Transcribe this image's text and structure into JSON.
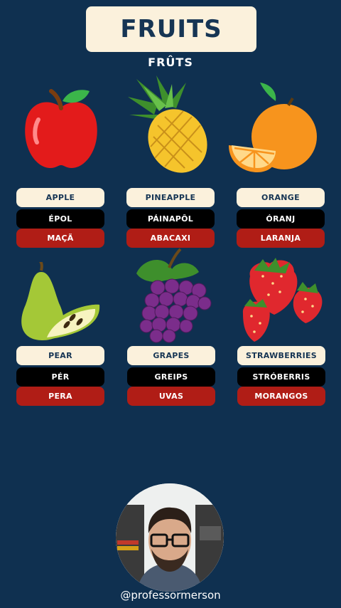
{
  "header": {
    "title": "FRUITS",
    "subtitle": "FRÛTS"
  },
  "fruits": [
    {
      "icon": "apple-icon",
      "english": "APPLE",
      "pronunciation": "ÉPOL",
      "portuguese": "MAÇÃ"
    },
    {
      "icon": "pineapple-icon",
      "english": "PINEAPPLE",
      "pronunciation": "PÁINAPÔL",
      "portuguese": "ABACAXI"
    },
    {
      "icon": "orange-icon",
      "english": "ORANGE",
      "pronunciation": "ÓRANJ",
      "portuguese": "LARANJA"
    },
    {
      "icon": "pear-icon",
      "english": "PEAR",
      "pronunciation": "PÉR",
      "portuguese": "PERA"
    },
    {
      "icon": "grapes-icon",
      "english": "GRAPES",
      "pronunciation": "GREIPS",
      "portuguese": "UVAS"
    },
    {
      "icon": "strawberry-icon",
      "english": "STRAWBERRIES",
      "pronunciation": "STRÓBERRIS",
      "portuguese": "MORANGOS"
    }
  ],
  "colors": {
    "background": "#0f3050",
    "cream": "#fbf1dc",
    "dark_text": "#163554",
    "black_pill": "#000000",
    "red_pill": "#b01d16"
  },
  "presenter": {
    "handle": "@professormerson"
  }
}
